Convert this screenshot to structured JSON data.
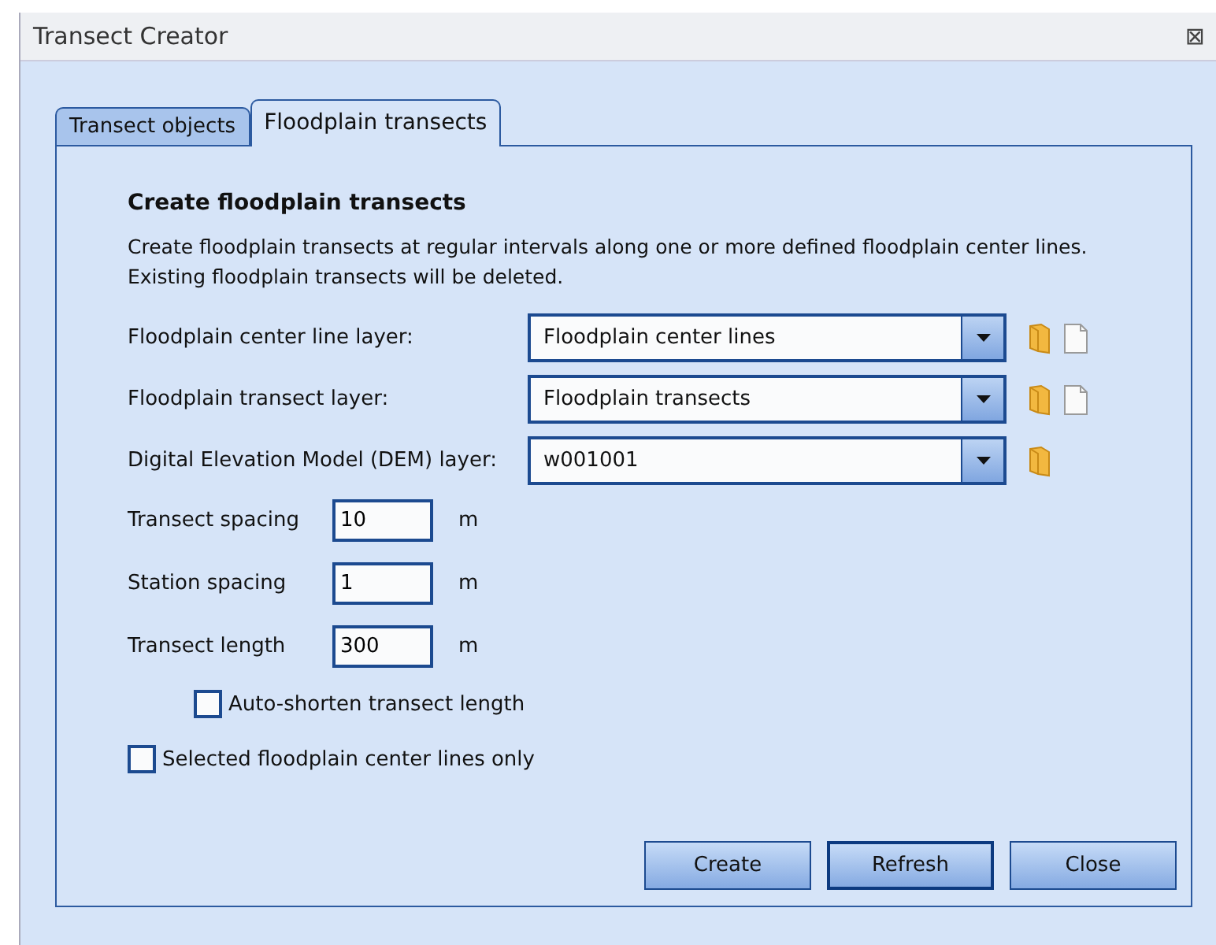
{
  "window": {
    "title": "Transect Creator",
    "close": "⊠"
  },
  "tabs": [
    {
      "label": "Transect objects",
      "selected": false
    },
    {
      "label": "Floodplain transects",
      "selected": true
    }
  ],
  "heading": "Create floodplain transects",
  "description": [
    "Create floodplain transects at regular intervals along one or more defined floodplain center lines.",
    "Existing floodplain transects will be deleted."
  ],
  "layers": [
    {
      "label": "Floodplain center line layer:",
      "value": "Floodplain center lines",
      "actions": [
        {
          "kind": "folder"
        },
        {
          "kind": "file"
        }
      ]
    },
    {
      "label": "Floodplain transect layer:",
      "value": "Floodplain transects",
      "actions": [
        {
          "kind": "folder"
        },
        {
          "kind": "file"
        }
      ]
    },
    {
      "label": "Digital Elevation Model (DEM) layer:",
      "value": "w001001",
      "actions": [
        {
          "kind": "folder"
        }
      ]
    }
  ],
  "fields": [
    {
      "label": "Transect spacing",
      "value": "10",
      "unit": "m"
    },
    {
      "label": "Station spacing",
      "value": "1",
      "unit": "m"
    },
    {
      "label": "Transect length",
      "value": "300",
      "unit": "m"
    }
  ],
  "checkboxes": [
    {
      "label": "Auto-shorten transect length",
      "checked": false,
      "kind": "sub"
    },
    {
      "label": "Selected floodplain center lines only",
      "checked": false,
      "kind": "main"
    }
  ],
  "buttons": [
    {
      "label": "Create",
      "focused": false
    },
    {
      "label": "Refresh",
      "focused": true
    },
    {
      "label": "Close",
      "focused": false
    }
  ]
}
